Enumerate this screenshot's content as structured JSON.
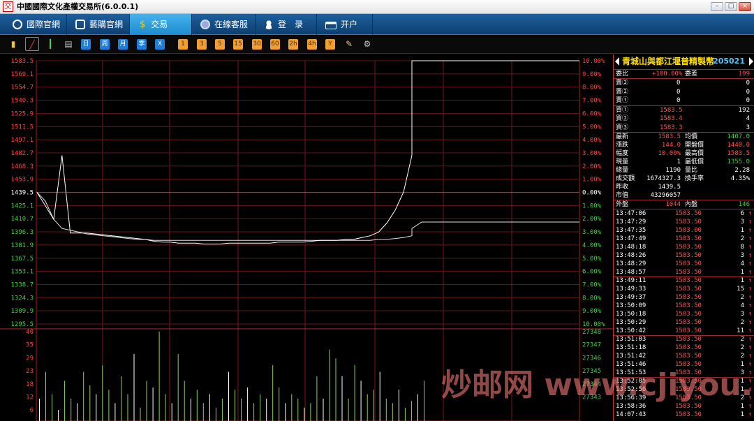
{
  "window": {
    "title": "中國國際文化產權交易所(6.0.0.1)",
    "icon_glyph": "交"
  },
  "nav": [
    {
      "label": "國際官網",
      "icon": "globe-icon"
    },
    {
      "label": "藝購官網",
      "icon": "link-icon"
    },
    {
      "label": "交易",
      "icon": "dollar-icon",
      "active": true
    },
    {
      "label": "在線客服",
      "icon": "chat-icon"
    },
    {
      "label": "登　录",
      "icon": "user-icon"
    },
    {
      "label": "开户",
      "icon": "card-icon"
    }
  ],
  "toolbar": {
    "period_buttons": [
      "日",
      "周",
      "月",
      "季",
      "X"
    ],
    "minute_buttons": [
      "1",
      "3",
      "5",
      "15",
      "30",
      "60",
      "2h",
      "4h",
      "Y"
    ]
  },
  "chart_data": {
    "type": "line",
    "price_ticks_left": [
      "1583.5",
      "1569.1",
      "1554.7",
      "1540.3",
      "1525.9",
      "1511.5",
      "1497.1",
      "1482.7",
      "1468.3",
      "1453.9",
      "1439.5",
      "1425.1",
      "1410.7",
      "1396.3",
      "1381.9",
      "1367.5",
      "1353.1",
      "1338.7",
      "1324.3",
      "1309.9",
      "1295.5"
    ],
    "percent_ticks_right": [
      "10.00%",
      "9.00%",
      "8.00%",
      "7.00%",
      "6.00%",
      "5.00%",
      "4.00%",
      "3.00%",
      "2.00%",
      "1.00%",
      "0.00%",
      "1.00%",
      "2.00%",
      "3.00%",
      "4.00%",
      "5.00%",
      "6.00%",
      "7.00%",
      "8.00%",
      "9.00%",
      "10.00%"
    ],
    "prev_close": 1439.5,
    "ylim": [
      1295.5,
      1583.5
    ],
    "price_series": [
      1439.5,
      1425,
      1410,
      1480,
      1395,
      1395,
      1395,
      1394,
      1393,
      1392,
      1391,
      1390,
      1389,
      1388,
      1386,
      1385,
      1385,
      1384,
      1384,
      1384,
      1383,
      1383,
      1383,
      1384,
      1384,
      1384,
      1384,
      1384,
      1384,
      1385,
      1385,
      1385,
      1385,
      1386,
      1387,
      1387,
      1387,
      1388,
      1388,
      1390,
      1392,
      1396,
      1406,
      1420,
      1440,
      1480,
      1583.5,
      1583.5,
      1583.5,
      1583.5,
      1583.5,
      1583.5,
      1583.5,
      1583.5,
      1583.5,
      1583.5,
      1583.5,
      1583.5,
      1583.5,
      1583.5,
      1583.5,
      1583.5,
      1583.5,
      1583.5
    ],
    "avg_series": [
      1439.5,
      1430,
      1410,
      1400,
      1398,
      1396,
      1394,
      1393,
      1392,
      1391,
      1390,
      1389,
      1388,
      1388,
      1387,
      1387,
      1387,
      1387,
      1387,
      1387,
      1387,
      1387,
      1387,
      1387,
      1387,
      1387,
      1387,
      1387,
      1387,
      1387,
      1387,
      1387,
      1387,
      1387,
      1387,
      1387,
      1387,
      1387,
      1387,
      1387,
      1387,
      1388,
      1388,
      1389,
      1390,
      1392,
      1400,
      1407,
      1407,
      1407,
      1407,
      1407,
      1407,
      1407,
      1407,
      1407,
      1407,
      1407,
      1407,
      1407,
      1407,
      1407,
      1407,
      1407
    ],
    "volume_ticks_left": [
      "40",
      "35",
      "29",
      "23",
      "18",
      "12",
      "6"
    ],
    "volume_ticks_right": [
      "27348",
      "27347",
      "27346",
      "27345",
      "27344",
      "27343"
    ],
    "volume_series": [
      10,
      22,
      12,
      5,
      18,
      10,
      8,
      22,
      16,
      12,
      25,
      14,
      8,
      20,
      12,
      30,
      6,
      18,
      15,
      40,
      12,
      8,
      30,
      18,
      10,
      14,
      8,
      12,
      6,
      10,
      22,
      14,
      10,
      15,
      8,
      12,
      10,
      25,
      15,
      8,
      12,
      10,
      6,
      8,
      20,
      10,
      32,
      28,
      20,
      10,
      25,
      18,
      12,
      14,
      22,
      10,
      8,
      14,
      6,
      9,
      12,
      18
    ]
  },
  "quote": {
    "name": "青城山與都江堰普精製幣",
    "code": "205021",
    "webi": {
      "label": "委比",
      "value": "+100.00%",
      "label2": "委差",
      "value2": "199"
    },
    "sell": [
      {
        "label": "賣③",
        "price": "0",
        "vol": "0"
      },
      {
        "label": "賣②",
        "price": "0",
        "vol": "0"
      },
      {
        "label": "賣①",
        "price": "0",
        "vol": "0"
      }
    ],
    "buy": [
      {
        "label": "買①",
        "price": "1583.5",
        "vol": "192"
      },
      {
        "label": "買②",
        "price": "1583.4",
        "vol": "4"
      },
      {
        "label": "買③",
        "price": "1583.3",
        "vol": "3"
      }
    ],
    "stats": [
      {
        "l1": "最新",
        "v1": "1583.5",
        "c1": "#ff5050",
        "l2": "均價",
        "v2": "1407.0",
        "c2": "#40d040"
      },
      {
        "l1": "漲跌",
        "v1": "144.0",
        "c1": "#ff5050",
        "l2": "開盤價",
        "v2": "1440.0",
        "c2": "#ff5050"
      },
      {
        "l1": "幅度",
        "v1": "10.00%",
        "c1": "#ff5050",
        "l2": "最高價",
        "v2": "1583.5",
        "c2": "#ff5050"
      },
      {
        "l1": "現量",
        "v1": "1",
        "c1": "#ffffff",
        "l2": "最低價",
        "v2": "1355.0",
        "c2": "#40d040"
      },
      {
        "l1": "總量",
        "v1": "1190",
        "c1": "#ffffff",
        "l2": "量比",
        "v2": "2.28",
        "c2": "#ffffff"
      },
      {
        "l1": "成交額",
        "v1": "1674327.3",
        "c1": "#ffffff",
        "l2": "換手率",
        "v2": "4.35%",
        "c2": "#ffffff"
      },
      {
        "l1": "昨收",
        "v1": "1439.5",
        "c1": "#ffffff",
        "l2": "",
        "v2": "",
        "c2": "#ffffff"
      },
      {
        "l1": "市值",
        "v1": "43296057",
        "c1": "#ffffff",
        "l2": "",
        "v2": "",
        "c2": "#ffffff"
      }
    ],
    "outer": {
      "label": "外盤",
      "value": "1044",
      "label2": "內盤",
      "value2": "146"
    },
    "ticks": [
      {
        "t": "13:47:06",
        "p": "1583.50",
        "v": "6"
      },
      {
        "t": "13:47:29",
        "p": "1583.50",
        "v": "3"
      },
      {
        "t": "13:47:35",
        "p": "1583.00",
        "v": "1"
      },
      {
        "t": "13:47:49",
        "p": "1583.50",
        "v": "2"
      },
      {
        "t": "13:48:18",
        "p": "1583.50",
        "v": "8"
      },
      {
        "t": "13:48:26",
        "p": "1583.50",
        "v": "3"
      },
      {
        "t": "13:48:29",
        "p": "1583.50",
        "v": "4"
      },
      {
        "t": "13:48:57",
        "p": "1583.50",
        "v": "1"
      },
      {
        "t": "13:49:11",
        "p": "1583.50",
        "v": "1"
      },
      {
        "t": "13:49:33",
        "p": "1583.50",
        "v": "15"
      },
      {
        "t": "13:49:37",
        "p": "1583.50",
        "v": "2"
      },
      {
        "t": "13:50:09",
        "p": "1583.50",
        "v": "4"
      },
      {
        "t": "13:50:18",
        "p": "1583.50",
        "v": "3"
      },
      {
        "t": "13:50:29",
        "p": "1583.50",
        "v": "2"
      },
      {
        "t": "13:50:42",
        "p": "1583.50",
        "v": "11"
      },
      {
        "t": "13:51:03",
        "p": "1583.50",
        "v": "2"
      },
      {
        "t": "13:51:18",
        "p": "1583.50",
        "v": "2"
      },
      {
        "t": "13:51:42",
        "p": "1583.50",
        "v": "2"
      },
      {
        "t": "13:51:46",
        "p": "1583.50",
        "v": "1"
      },
      {
        "t": "13:51:53",
        "p": "1583.50",
        "v": "3"
      },
      {
        "t": "13:52:05",
        "p": "1583.50",
        "v": "1"
      },
      {
        "t": "13:52:56",
        "p": "1583.50",
        "v": "1"
      },
      {
        "t": "13:56:39",
        "p": "1583.50",
        "v": "2"
      },
      {
        "t": "13:58:36",
        "p": "1583.50",
        "v": "1"
      },
      {
        "t": "14:07:43",
        "p": "1583.50",
        "v": "1"
      }
    ],
    "tick_arrow": "↑"
  },
  "watermark": "炒邮网 www.cjiyou.net"
}
